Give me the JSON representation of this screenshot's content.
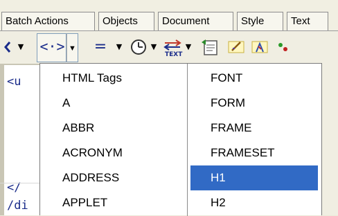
{
  "tabs": [
    "Batch Actions",
    "Objects",
    "Document",
    "Style",
    "Text"
  ],
  "toolbar": {
    "items": [
      {
        "icon": "partial-icon"
      },
      {
        "icon": "tag-icon",
        "glyph": "<·>"
      },
      {
        "icon": "equals-icon",
        "glyph": "="
      },
      {
        "icon": "clock-icon",
        "glyph": "⏲"
      },
      {
        "icon": "text-color-icon",
        "glyph": "⇆"
      },
      {
        "icon": "page-icon",
        "glyph": "▤"
      },
      {
        "icon": "edit-icon",
        "glyph": "✎"
      },
      {
        "icon": "user-icon",
        "glyph": "♟"
      }
    ]
  },
  "editor": {
    "lines": [
      "<u",
      "</",
      "/di"
    ]
  },
  "menu": {
    "left_items": [
      "HTML Tags",
      "A",
      "ABBR",
      "ACRONYM",
      "ADDRESS",
      "APPLET"
    ],
    "right_items": [
      "FONT",
      "FORM",
      "FRAME",
      "FRAMESET",
      "H1",
      "H2"
    ],
    "selected": "H1"
  }
}
